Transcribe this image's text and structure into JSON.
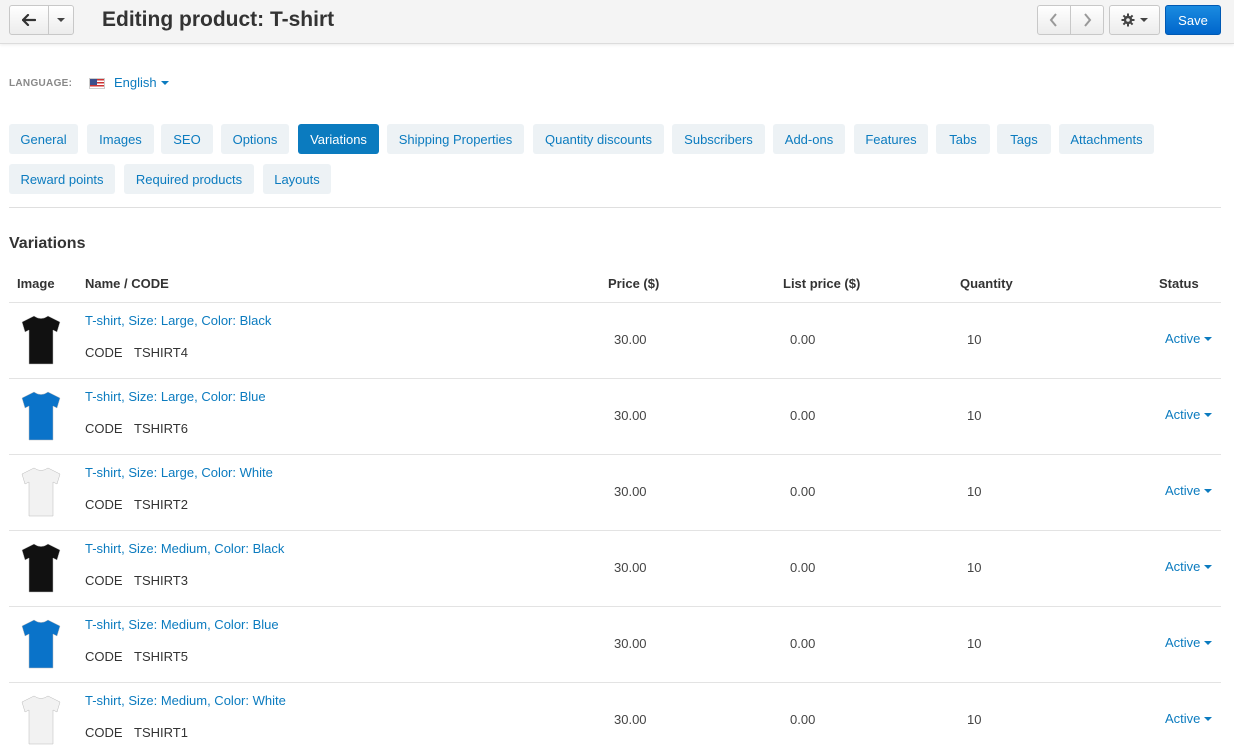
{
  "header": {
    "title": "Editing product: T-shirt",
    "save_label": "Save"
  },
  "language": {
    "label": "LANGUAGE:",
    "value": "English"
  },
  "tabs": [
    {
      "label": "General",
      "active": false
    },
    {
      "label": "Images",
      "active": false
    },
    {
      "label": "SEO",
      "active": false
    },
    {
      "label": "Options",
      "active": false
    },
    {
      "label": "Variations",
      "active": true
    },
    {
      "label": "Shipping Properties",
      "active": false
    },
    {
      "label": "Quantity discounts",
      "active": false
    },
    {
      "label": "Subscribers",
      "active": false
    },
    {
      "label": "Add-ons",
      "active": false
    },
    {
      "label": "Features",
      "active": false
    },
    {
      "label": "Tabs",
      "active": false
    },
    {
      "label": "Tags",
      "active": false
    },
    {
      "label": "Attachments",
      "active": false
    },
    {
      "label": "Reward points",
      "active": false
    },
    {
      "label": "Required products",
      "active": false
    },
    {
      "label": "Layouts",
      "active": false
    }
  ],
  "section": {
    "title": "Variations"
  },
  "table": {
    "headers": {
      "image": "Image",
      "name": "Name / CODE",
      "price": "Price ($)",
      "list_price": "List price ($)",
      "quantity": "Quantity",
      "status": "Status"
    },
    "code_label": "CODE",
    "rows": [
      {
        "name": "T-shirt, Size: Large, Color: Black",
        "code": "TSHIRT4",
        "price": "30.00",
        "list_price": "0.00",
        "quantity": "10",
        "status": "Active",
        "shirt_color": "#111111"
      },
      {
        "name": "T-shirt, Size: Large, Color: Blue",
        "code": "TSHIRT6",
        "price": "30.00",
        "list_price": "0.00",
        "quantity": "10",
        "status": "Active",
        "shirt_color": "#0a73c9"
      },
      {
        "name": "T-shirt, Size: Large, Color: White",
        "code": "TSHIRT2",
        "price": "30.00",
        "list_price": "0.00",
        "quantity": "10",
        "status": "Active",
        "shirt_color": "#f2f2f2"
      },
      {
        "name": "T-shirt, Size: Medium, Color: Black",
        "code": "TSHIRT3",
        "price": "30.00",
        "list_price": "0.00",
        "quantity": "10",
        "status": "Active",
        "shirt_color": "#111111"
      },
      {
        "name": "T-shirt, Size: Medium, Color: Blue",
        "code": "TSHIRT5",
        "price": "30.00",
        "list_price": "0.00",
        "quantity": "10",
        "status": "Active",
        "shirt_color": "#0a73c9"
      },
      {
        "name": "T-shirt, Size: Medium, Color: White",
        "code": "TSHIRT1",
        "price": "30.00",
        "list_price": "0.00",
        "quantity": "10",
        "status": "Active",
        "shirt_color": "#f2f2f2"
      }
    ]
  },
  "colors": {
    "accent": "#0b7bbf",
    "save_button": "#0066cc",
    "tab_bg": "#edf2f5"
  }
}
